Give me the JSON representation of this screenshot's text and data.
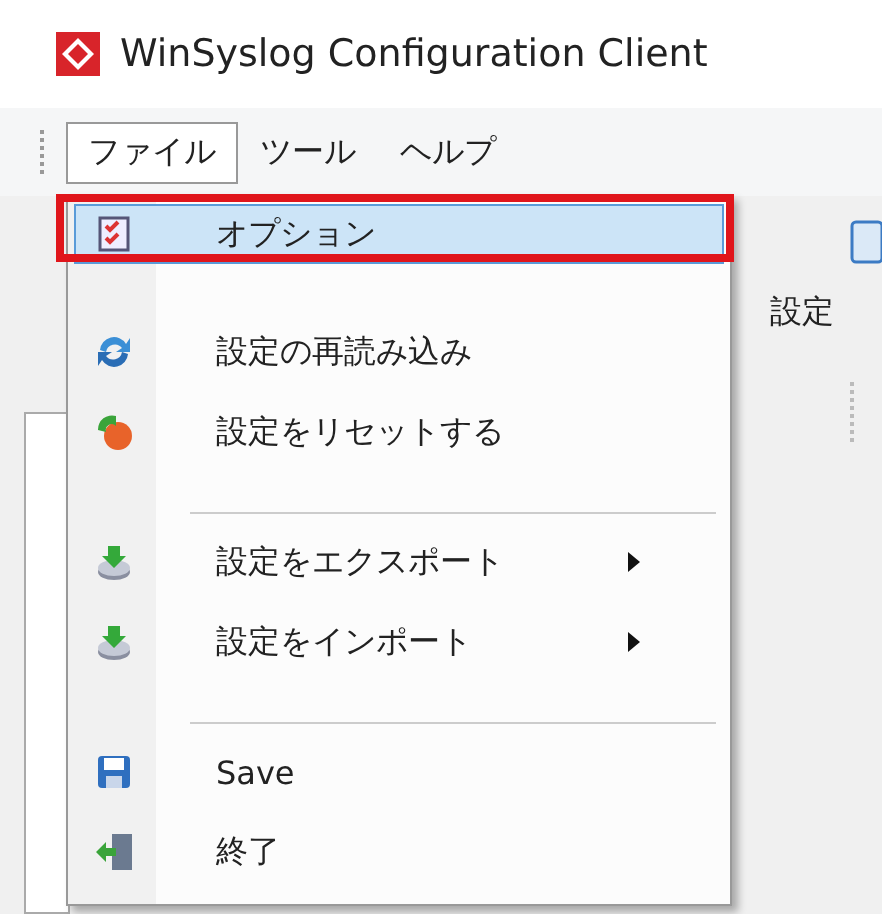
{
  "window": {
    "title": "WinSyslog Configuration Client"
  },
  "menu_bar": [
    {
      "label": "ファイル",
      "selected": true
    },
    {
      "label": "ツール",
      "selected": false
    },
    {
      "label": "ヘルプ",
      "selected": false
    }
  ],
  "toolbar": {
    "button_label": "設定"
  },
  "file_menu": [
    {
      "kind": "item",
      "label": "オプション",
      "selected": true,
      "submenu": false
    },
    {
      "kind": "item",
      "label": "設定の再読み込み",
      "selected": false,
      "submenu": false
    },
    {
      "kind": "item",
      "label": "設定をリセットする",
      "selected": false,
      "submenu": false
    },
    {
      "kind": "separator"
    },
    {
      "kind": "item",
      "label": "設定をエクスポート",
      "selected": false,
      "submenu": true
    },
    {
      "kind": "item",
      "label": "設定をインポート",
      "selected": false,
      "submenu": true
    },
    {
      "kind": "separator"
    },
    {
      "kind": "item",
      "label": "Save",
      "selected": false,
      "submenu": false
    },
    {
      "kind": "item",
      "label": "終了",
      "selected": false,
      "submenu": false
    }
  ]
}
